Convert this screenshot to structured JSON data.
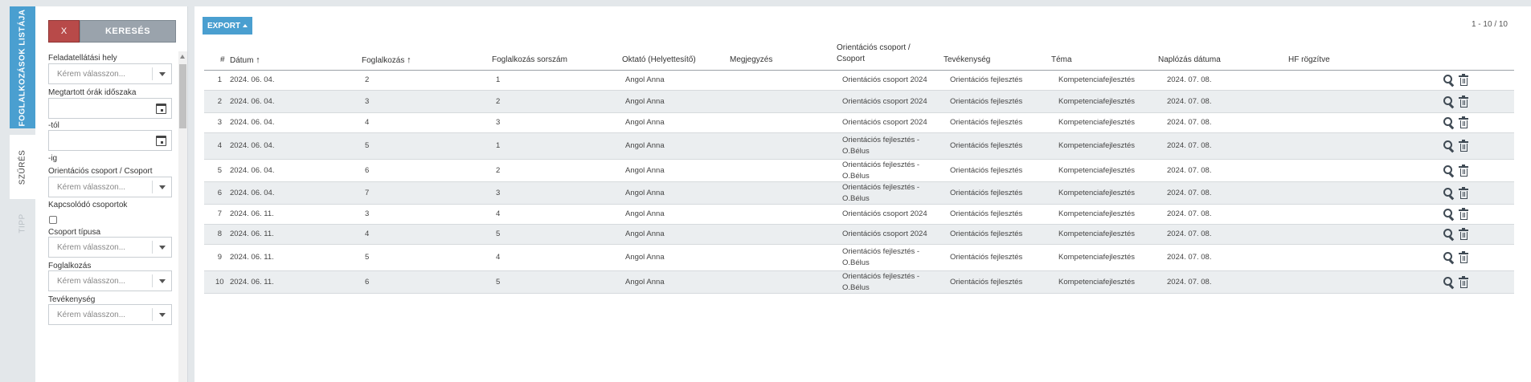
{
  "tabs": {
    "list": "FOGLALKOZÁSOK LISTÁJA",
    "filter": "SZŰRÉS",
    "tip": "TIPP"
  },
  "filter": {
    "clear_label": "X",
    "search_label": "KERESÉS",
    "labels": {
      "feladatellatasi_hely": "Feladatellátási hely",
      "megtartott_orak": "Megtartott órák időszaka",
      "tol": "-tól",
      "ig": "-ig",
      "orientacios_csoport": "Orientációs csoport / Csoport",
      "kapcsolodo_csoportok": "Kapcsolódó csoportok",
      "csoport_tipusa": "Csoport típusa",
      "foglalkozas": "Foglalkozás",
      "tevekenyseg": "Tevékenység"
    },
    "placeholder": "Kérem válasszon..."
  },
  "main": {
    "export_label": "EXPORT",
    "pagination": "1 - 10 / 10"
  },
  "table": {
    "headers": {
      "num": "#",
      "datum": "Dátum",
      "foglalkozas": "Foglalkozás",
      "sorszam": "Foglalkozás sorszám",
      "oktato": "Oktató (Helyettesítő)",
      "megjegyzes": "Megjegyzés",
      "orientacios_line1": "Orientációs csoport /",
      "orientacios_line2": "Csoport",
      "tevekenyseg": "Tevékenység",
      "tema": "Téma",
      "naplozas": "Naplózás dátuma",
      "hf": "HF rögzítve"
    },
    "sort_arrow": "↑",
    "rows": [
      {
        "num": "1",
        "datum": "2024. 06. 04.",
        "foglalkozas": "2",
        "sorszam": "1",
        "oktato": "Angol Anna",
        "megjegyzes": "",
        "csoport1": "Orientációs csoport 2024",
        "csoport2": "",
        "tevekenyseg": "Orientációs fejlesztés",
        "tema": "Kompetenciafejlesztés",
        "naplozas": "2024. 07. 08.",
        "hf": ""
      },
      {
        "num": "2",
        "datum": "2024. 06. 04.",
        "foglalkozas": "3",
        "sorszam": "2",
        "oktato": "Angol Anna",
        "megjegyzes": "",
        "csoport1": "Orientációs csoport 2024",
        "csoport2": "",
        "tevekenyseg": "Orientációs fejlesztés",
        "tema": "Kompetenciafejlesztés",
        "naplozas": "2024. 07. 08.",
        "hf": ""
      },
      {
        "num": "3",
        "datum": "2024. 06. 04.",
        "foglalkozas": "4",
        "sorszam": "3",
        "oktato": "Angol Anna",
        "megjegyzes": "",
        "csoport1": "Orientációs csoport 2024",
        "csoport2": "",
        "tevekenyseg": "Orientációs fejlesztés",
        "tema": "Kompetenciafejlesztés",
        "naplozas": "2024. 07. 08.",
        "hf": ""
      },
      {
        "num": "4",
        "datum": "2024. 06. 04.",
        "foglalkozas": "5",
        "sorszam": "1",
        "oktato": "Angol Anna",
        "megjegyzes": "",
        "csoport1": "Orientációs fejlesztés -",
        "csoport2": "O.Bélus",
        "tevekenyseg": "Orientációs fejlesztés",
        "tema": "Kompetenciafejlesztés",
        "naplozas": "2024. 07. 08.",
        "hf": ""
      },
      {
        "num": "5",
        "datum": "2024. 06. 04.",
        "foglalkozas": "6",
        "sorszam": "2",
        "oktato": "Angol Anna",
        "megjegyzes": "",
        "csoport1": "Orientációs fejlesztés -",
        "csoport2": "O.Bélus",
        "tevekenyseg": "Orientációs fejlesztés",
        "tema": "Kompetenciafejlesztés",
        "naplozas": "2024. 07. 08.",
        "hf": ""
      },
      {
        "num": "6",
        "datum": "2024. 06. 04.",
        "foglalkozas": "7",
        "sorszam": "3",
        "oktato": "Angol Anna",
        "megjegyzes": "",
        "csoport1": "Orientációs fejlesztés -",
        "csoport2": "O.Bélus",
        "tevekenyseg": "Orientációs fejlesztés",
        "tema": "Kompetenciafejlesztés",
        "naplozas": "2024. 07. 08.",
        "hf": ""
      },
      {
        "num": "7",
        "datum": "2024. 06. 11.",
        "foglalkozas": "3",
        "sorszam": "4",
        "oktato": "Angol Anna",
        "megjegyzes": "",
        "csoport1": "Orientációs csoport 2024",
        "csoport2": "",
        "tevekenyseg": "Orientációs fejlesztés",
        "tema": "Kompetenciafejlesztés",
        "naplozas": "2024. 07. 08.",
        "hf": ""
      },
      {
        "num": "8",
        "datum": "2024. 06. 11.",
        "foglalkozas": "4",
        "sorszam": "5",
        "oktato": "Angol Anna",
        "megjegyzes": "",
        "csoport1": "Orientációs csoport 2024",
        "csoport2": "",
        "tevekenyseg": "Orientációs fejlesztés",
        "tema": "Kompetenciafejlesztés",
        "naplozas": "2024. 07. 08.",
        "hf": ""
      },
      {
        "num": "9",
        "datum": "2024. 06. 11.",
        "foglalkozas": "5",
        "sorszam": "4",
        "oktato": "Angol Anna",
        "megjegyzes": "",
        "csoport1": "Orientációs fejlesztés -",
        "csoport2": "O.Bélus",
        "tevekenyseg": "Orientációs fejlesztés",
        "tema": "Kompetenciafejlesztés",
        "naplozas": "2024. 07. 08.",
        "hf": ""
      },
      {
        "num": "10",
        "datum": "2024. 06. 11.",
        "foglalkozas": "6",
        "sorszam": "5",
        "oktato": "Angol Anna",
        "megjegyzes": "",
        "csoport1": "Orientációs fejlesztés -",
        "csoport2": "O.Bélus",
        "tevekenyseg": "Orientációs fejlesztés",
        "tema": "Kompetenciafejlesztés",
        "naplozas": "2024. 07. 08.",
        "hf": ""
      }
    ]
  },
  "icons": {
    "view": "search-icon",
    "delete": "trash-icon",
    "calendar": "calendar-icon",
    "dropdown": "chevron-down-icon"
  },
  "colors": {
    "primary": "#4a9fd0",
    "danger": "#b84a49",
    "search_button": "#9aa3ac",
    "row_alt": "#ebeef0"
  }
}
